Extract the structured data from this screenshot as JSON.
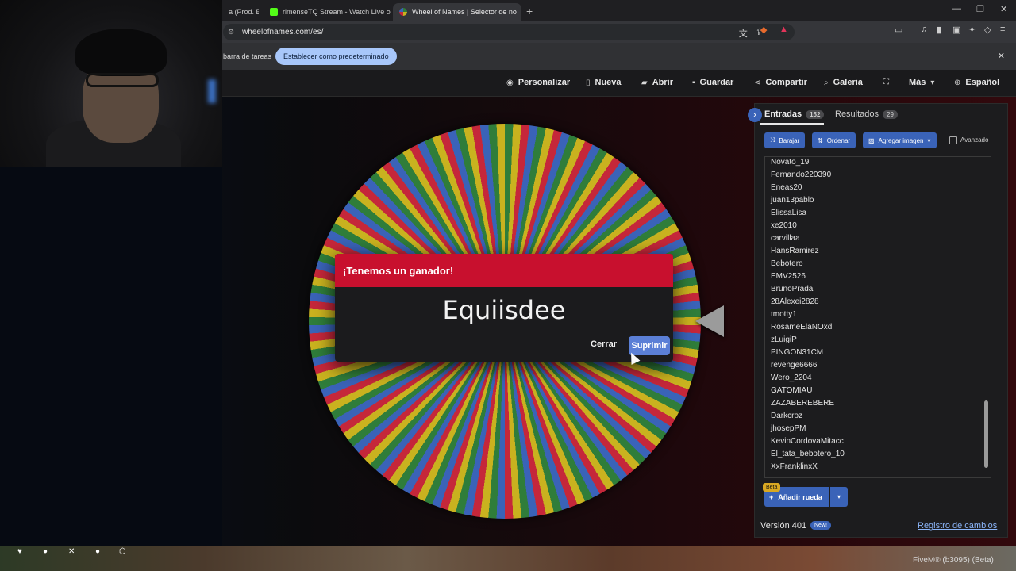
{
  "browser": {
    "tabs": [
      {
        "label": "a (Prod. Be",
        "active": false
      },
      {
        "label": "rimenseTQ Stream - Watch Live on K",
        "active": false
      },
      {
        "label": "Wheel of Names | Selector de no",
        "active": true
      }
    ],
    "address": "wheelofnames.com/es/",
    "infobar_text": "barra de tareas",
    "infobar_button": "Establecer como predeterminado",
    "ext_badge_1": "2",
    "ext_badge_2": "1"
  },
  "site_nav": {
    "items": [
      "Personalizar",
      "Nueva",
      "Abrir",
      "Guardar",
      "Compartir",
      "Galeria",
      "Más",
      "Español"
    ]
  },
  "modal": {
    "title": "¡Tenemos un ganador!",
    "winner": "Equiisdee",
    "close_label": "Cerrar",
    "remove_label": "Suprimir"
  },
  "panel": {
    "tab_entries": "Entradas",
    "tab_entries_count": "152",
    "tab_results": "Resultados",
    "tab_results_count": "29",
    "shuffle_label": "Barajar",
    "sort_label": "Ordenar",
    "add_image_label": "Agregar imagen",
    "advanced_label": "Avanzado",
    "entries": [
      "Novato_19",
      "Fernando220390",
      "Eneas20",
      "juan13pablo",
      "ElissaLisa",
      "xe2010",
      "carvillaa",
      "HansRamirez",
      "Bebotero",
      "EMV2526",
      "BrunoPrada",
      "28Alexei2828",
      "tmotty1",
      "RosameElaNOxd",
      "zLuigiP",
      "PINGON31CM",
      "revenge6666",
      "Wero_2204",
      "GATOMIAU",
      "ZAZABEREBERE",
      "Darkcroz",
      "jhosepPM",
      "KevinCordovaMitacc",
      "El_tata_bebotero_10",
      "XxFranklinxX"
    ],
    "beta_label": "Beta",
    "add_wheel_label": "Añadir rueda",
    "version_label": "Versión 401",
    "new_badge": "New!",
    "changelog_label": "Registro de cambios"
  },
  "game": {
    "overlay_text": "FiveM® (b3095) (Beta)"
  },
  "colors": {
    "modal_header": "#c8102e",
    "accent_blue": "#3a63b8",
    "wheel_green": "#2f7d3a",
    "wheel_yellow": "#c9b21f",
    "wheel_red": "#c5273a",
    "wheel_blue": "#3a63b8"
  }
}
